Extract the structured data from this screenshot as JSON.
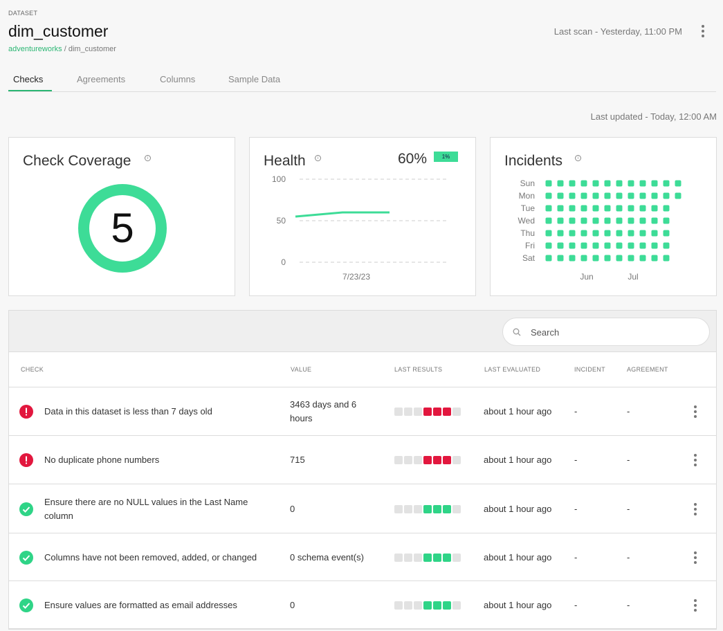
{
  "header": {
    "eyebrow": "DATASET",
    "title": "dim_customer",
    "breadcrumb_link": "adventureworks",
    "breadcrumb_sep": " / ",
    "breadcrumb_current": "dim_customer",
    "last_scan": "Last scan - Yesterday, 11:00 PM"
  },
  "tabs": [
    {
      "label": "Checks",
      "active": true
    },
    {
      "label": "Agreements",
      "active": false
    },
    {
      "label": "Columns",
      "active": false
    },
    {
      "label": "Sample Data",
      "active": false
    }
  ],
  "last_updated": "Last updated - Today, 12:00 AM",
  "coverage": {
    "title": "Check Coverage",
    "info_icon": "i",
    "value": "5"
  },
  "health": {
    "title": "Health",
    "info_icon": "i",
    "percent": "60%",
    "badge": "1%",
    "chart_data": {
      "type": "line",
      "ylim": [
        0,
        100
      ],
      "yticks": [
        "100",
        "50",
        "0"
      ],
      "xlabel_tick": "7/23/23",
      "series": [
        {
          "values": [
            55,
            60,
            60
          ]
        }
      ],
      "grid": true
    }
  },
  "incidents": {
    "title": "Incidents",
    "info_icon": "i",
    "days": [
      "Sun",
      "Mon",
      "Tue",
      "Wed",
      "Thu",
      "Fri",
      "Sat"
    ],
    "counts": [
      12,
      12,
      11,
      11,
      11,
      11,
      11
    ],
    "months": [
      "Jun",
      "Jul"
    ]
  },
  "search": {
    "placeholder": "Search",
    "icon": "search-icon"
  },
  "columns": [
    "CHECK",
    "VALUE",
    "LAST RESULTS",
    "LAST EVALUATED",
    "INCIDENT",
    "AGREEMENT"
  ],
  "colors": {
    "pass": "#2fd487",
    "fail": "#e2173e",
    "empty": "#e2e2e2",
    "accent": "#2bb673"
  },
  "rows": [
    {
      "status": "fail",
      "check": "Data in this dataset is less than 7 days old",
      "value": "3463 days and 6 hours",
      "results": [
        "empty",
        "empty",
        "empty",
        "fail",
        "fail",
        "fail",
        "empty"
      ],
      "evaluated": "about 1 hour ago",
      "incident": "-",
      "agreement": "-"
    },
    {
      "status": "fail",
      "check": "No duplicate phone numbers",
      "value": "715",
      "results": [
        "empty",
        "empty",
        "empty",
        "fail",
        "fail",
        "fail",
        "empty"
      ],
      "evaluated": "about 1 hour ago",
      "incident": "-",
      "agreement": "-"
    },
    {
      "status": "pass",
      "check": "Ensure there are no NULL values in the Last Name column",
      "value": "0",
      "results": [
        "empty",
        "empty",
        "empty",
        "pass",
        "pass",
        "pass",
        "empty"
      ],
      "evaluated": "about 1 hour ago",
      "incident": "-",
      "agreement": "-"
    },
    {
      "status": "pass",
      "check": "Columns have not been removed, added, or changed",
      "value": "0 schema event(s)",
      "results": [
        "empty",
        "empty",
        "empty",
        "pass",
        "pass",
        "pass",
        "empty"
      ],
      "evaluated": "about 1 hour ago",
      "incident": "-",
      "agreement": "-"
    },
    {
      "status": "pass",
      "check": "Ensure values are formatted as email addresses",
      "value": "0",
      "results": [
        "empty",
        "empty",
        "empty",
        "pass",
        "pass",
        "pass",
        "empty"
      ],
      "evaluated": "about 1 hour ago",
      "incident": "-",
      "agreement": "-"
    }
  ]
}
